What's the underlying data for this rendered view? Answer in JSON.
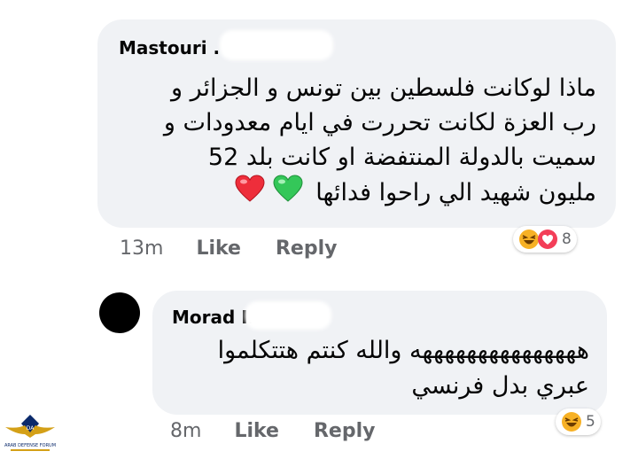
{
  "comments": [
    {
      "author": "Mastouri .",
      "lines": [
        "ماذا لوكانت فلسطين بين تونس و الجزائر و",
        "رب العزة  لكانت تحررت في ايام معدودات و",
        "سميت بالدولة المنتفضة او كانت بلد 52",
        "مليون شهيد الي راحوا فدائها"
      ],
      "inline_emojis": [
        "red-heart-icon",
        "green-heart-icon"
      ],
      "time": "13m",
      "like_label": "Like",
      "reply_label": "Reply",
      "reactions": [
        "laugh-icon",
        "love-icon"
      ],
      "reaction_count": "8"
    },
    {
      "author": "Morad I.",
      "lines": [
        "هههههههههههههههه والله كنتم هتتكلموا",
        "عبري بدل فرنسي"
      ],
      "time": "8m",
      "like_label": "Like",
      "reply_label": "Reply",
      "reactions": [
        "laugh-icon"
      ],
      "reaction_count": "5"
    }
  ],
  "watermark": {
    "text": "ARAB DEFENSE FORUM"
  },
  "colors": {
    "bubble": "#f0f2f5",
    "meta_text": "#65676b",
    "love": "#f33e58",
    "haha": "#f7b125"
  }
}
